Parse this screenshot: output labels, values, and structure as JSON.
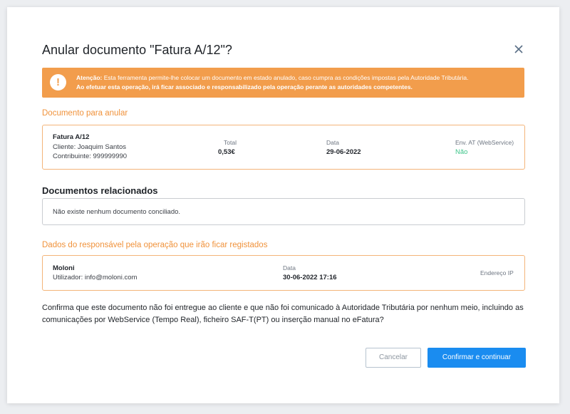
{
  "modal": {
    "title": "Anular documento \"Fatura A/12\"?",
    "close_icon": "close-icon"
  },
  "alert": {
    "icon": "exclamation-icon",
    "bold_prefix": "Atenção:",
    "line1": "Esta ferramenta permite-lhe colocar um documento em estado anulado, caso cumpra as condições impostas pela Autoridade Tributária.",
    "line2": "Ao efetuar esta operação, irá ficar associado e responsabilizado pela operação perante as autoridades competentes."
  },
  "document": {
    "section_title": "Documento para anular",
    "name": "Fatura A/12",
    "client": "Cliente: Joaquim Santos",
    "taxpayer": "Contribuinte: 999999990",
    "total_label": "Total",
    "total_value": "0,53€",
    "date_label": "Data",
    "date_value": "29-06-2022",
    "at_label": "Env. AT (WebService)",
    "at_value": "Não"
  },
  "related": {
    "section_title": "Documentos relacionados",
    "empty_text": "Não existe nenhum documento conciliado."
  },
  "responsible": {
    "section_title": "Dados do responsável pela operação que irão ficar registados",
    "name": "Moloni",
    "user": "Utilizador: info@moloni.com",
    "date_label": "Data",
    "date_value": "30-06-2022 17:16",
    "ip_label": "Endereço IP"
  },
  "confirm_text": "Confirma que este documento não foi entregue ao cliente e que não foi comunicado à Autoridade Tributária por nenhum meio, incluindo as comunicações por WebService (Tempo Real), ficheiro SAF-T(PT) ou inserção manual no eFatura?",
  "buttons": {
    "cancel": "Cancelar",
    "confirm": "Confirmar e continuar"
  },
  "colors": {
    "accent_orange": "#f29d4c",
    "primary_blue": "#1a8cf0",
    "success_green": "#3fc58b"
  }
}
